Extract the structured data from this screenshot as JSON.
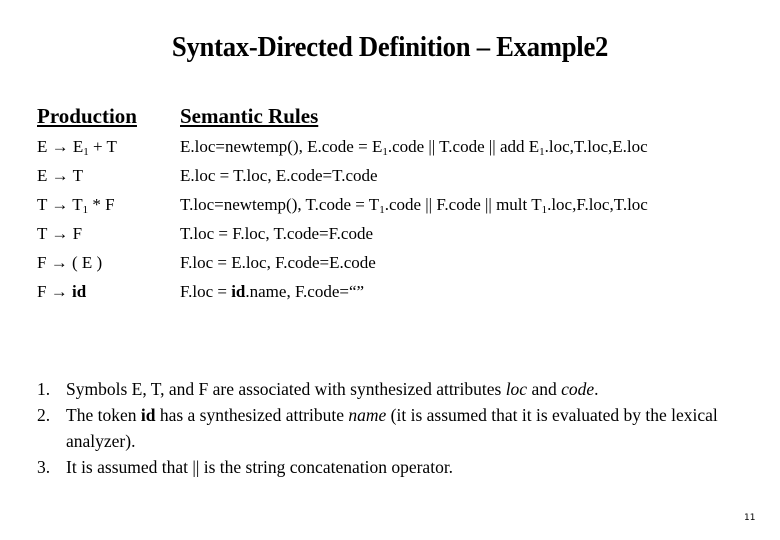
{
  "slide": {
    "title": "Syntax-Directed Definition – Example2",
    "page_number": "11"
  },
  "table": {
    "headers": {
      "production": "Production",
      "semantic_rules": "Semantic Rules"
    },
    "rows": [
      {
        "production": [
          "E → E",
          "1",
          " + T"
        ],
        "rule": [
          "E.loc=newtemp(),  E.code = E",
          "1",
          ".code || T.code  || add E",
          "1",
          ".loc,T.loc,E.loc"
        ]
      },
      {
        "production": [
          "E → T"
        ],
        "rule": [
          "E.loc = T.loc,  E.code=T.code"
        ]
      },
      {
        "production": [
          "T → T",
          "1",
          " * F"
        ],
        "rule": [
          "T.loc=newtemp(),  T.code = T",
          "1",
          ".code || F.code  || mult T",
          "1",
          ".loc,F.loc,T.loc"
        ]
      },
      {
        "production": [
          "T → F"
        ],
        "rule": [
          "T.loc = F.loc,  T.code=F.code"
        ]
      },
      {
        "production": [
          "F → ( E )"
        ],
        "rule": [
          "F.loc = E.loc,  F.code=E.code"
        ]
      },
      {
        "production": [
          "F → ",
          "id"
        ],
        "rule": [
          "F.loc = ",
          "id",
          ".name,  F.code=“”"
        ]
      }
    ]
  },
  "notes": [
    {
      "num": "1.",
      "parts": [
        "Symbols E, T, and F are associated with synthesized attributes  ",
        "loc",
        " and ",
        "code",
        "."
      ]
    },
    {
      "num": "2.",
      "parts": [
        "The token ",
        "id",
        " has a synthesized attribute ",
        "name",
        " (it is assumed that it is evaluated by the lexical analyzer)."
      ]
    },
    {
      "num": "3.",
      "parts": [
        "It is assumed that  ||  is the string concatenation operator."
      ]
    }
  ]
}
